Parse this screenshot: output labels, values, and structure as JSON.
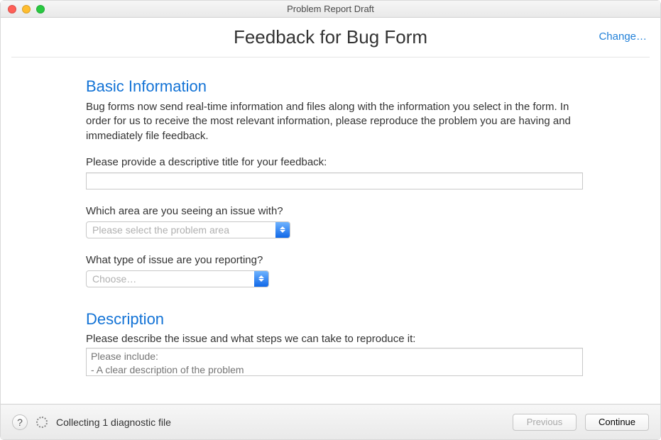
{
  "window": {
    "title": "Problem Report Draft"
  },
  "header": {
    "title": "Feedback for Bug Form",
    "change": "Change…"
  },
  "sections": {
    "basic": {
      "title": "Basic Information",
      "desc": "Bug forms now send real-time information and files along with the information you select in the form. In order for us to receive the most relevant information, please reproduce the problem you are having and immediately file feedback.",
      "title_field_label": "Please provide a descriptive title for your feedback:",
      "title_value": "",
      "area_label": "Which area are you seeing an issue with?",
      "area_placeholder": "Please select the problem area",
      "type_label": "What type of issue are you reporting?",
      "type_placeholder": "Choose…"
    },
    "description": {
      "title": "Description",
      "label": "Please describe the issue and what steps we can take to reproduce it:",
      "placeholder": "Please include:\n- A clear description of the problem"
    }
  },
  "footer": {
    "status": "Collecting 1 diagnostic file",
    "previous": "Previous",
    "continue": "Continue"
  }
}
